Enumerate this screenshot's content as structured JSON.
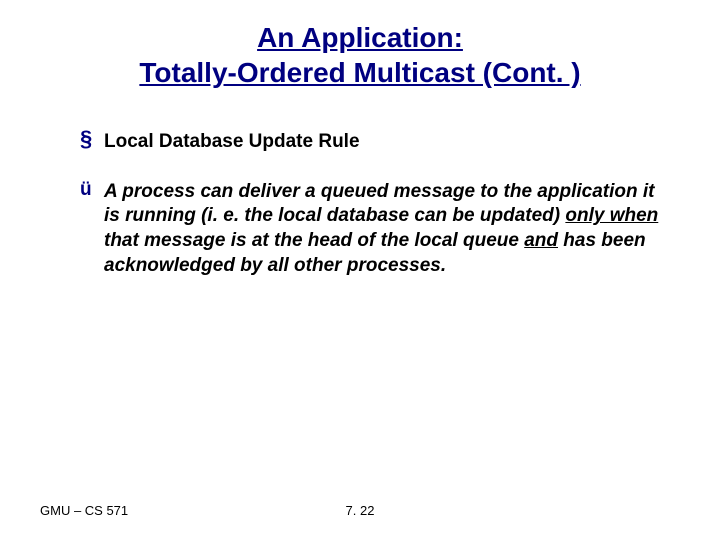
{
  "title": {
    "line1": "An Application:",
    "line2": "Totally-Ordered Multicast (Cont. )"
  },
  "bullet": {
    "mark": "§",
    "text": "Local Database Update Rule"
  },
  "sub": {
    "mark": "ü",
    "t1": "A  process can deliver a queued message to the application it is running  (i. e. the local database can be updated) ",
    "t_only_when": "only when",
    "t2": " that message is at the head of the local queue ",
    "t_and": "and",
    "t3": " has been acknowledged by all other processes."
  },
  "footer": {
    "left": "GMU – CS 571",
    "center": "7. 22"
  }
}
